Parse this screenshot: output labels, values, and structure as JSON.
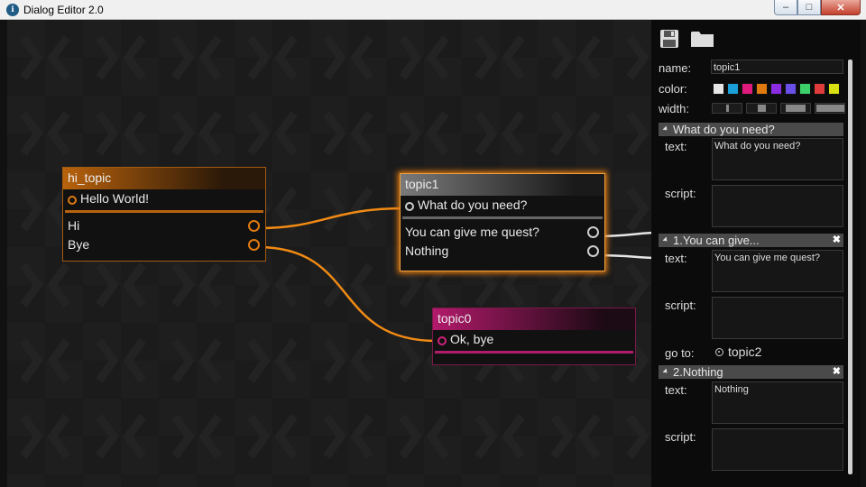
{
  "window": {
    "title": "Dialog Editor 2.0",
    "minimize": "–",
    "maximize": "□",
    "close": "✕",
    "app_icon": "ℹ"
  },
  "colors": {
    "orange": "#e07a10",
    "pink": "#b21a6b",
    "gray": "#808080",
    "wire": "#f08a14",
    "white_wire": "#e6e6e6"
  },
  "nodes": {
    "hi_topic": {
      "title": "hi_topic",
      "input": "Hello World!",
      "outputs": [
        "Hi",
        "Bye"
      ]
    },
    "topic1": {
      "title": "topic1",
      "input": "What do you need?",
      "outputs": [
        "You can give me quest?",
        "Nothing"
      ]
    },
    "topic0": {
      "title": "topic0",
      "input": "Ok, bye"
    }
  },
  "panel": {
    "toolbar": {
      "save_icon": "save-icon",
      "open_icon": "folder-icon"
    },
    "name_label": "name:",
    "name_value": "topic1",
    "color_label": "color:",
    "swatches": [
      "#e6e6e6",
      "#19a0d8",
      "#e0197d",
      "#e07a10",
      "#8b2be2",
      "#6a4ee8",
      "#3cd06a",
      "#e03a3a",
      "#d8e010"
    ],
    "width_label": "width:",
    "prompt": {
      "header": "What do you need?",
      "text_label": "text:",
      "text_value": "What do you need?",
      "script_label": "script:"
    },
    "answers": [
      {
        "header": "1.You can give...",
        "text_label": "text:",
        "text_value": "You can give me quest?",
        "script_label": "script:",
        "goto_label": "go to:",
        "goto_value": "topic2"
      },
      {
        "header": "2.Nothing",
        "text_label": "text:",
        "text_value": "Nothing",
        "script_label": "script:"
      }
    ],
    "close_icon": "✖"
  }
}
